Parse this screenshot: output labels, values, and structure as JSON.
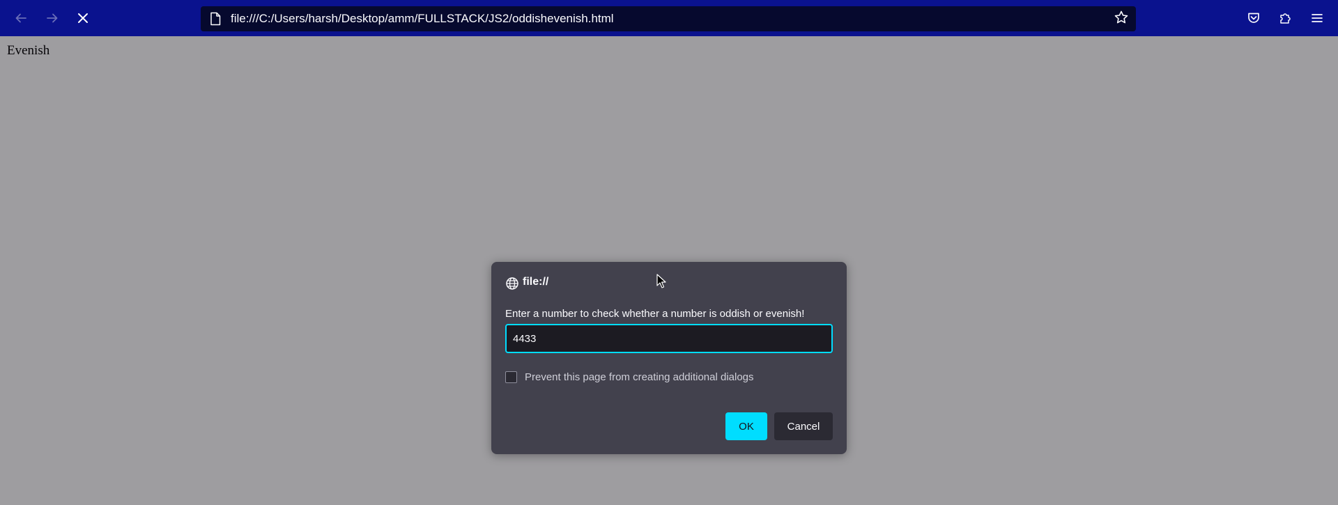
{
  "browser": {
    "url": "file:///C:/Users/harsh/Desktop/amm/FULLSTACK/JS2/oddishevenish.html",
    "toolbar_color": "#0a128e",
    "urlbar_color": "#06092e",
    "icons": {
      "back": "back-arrow-icon",
      "forward": "forward-arrow-icon",
      "stop": "stop-loading-icon",
      "page": "page-icon",
      "bookmark": "star-icon",
      "pocket": "pocket-icon",
      "extensions": "puzzle-extensions-icon",
      "menu": "hamburger-menu-icon"
    }
  },
  "page": {
    "text": "Evenish"
  },
  "dialog": {
    "origin": "file://",
    "message": "Enter a number to check whether a number is oddish or evenish!",
    "input_value": "4433",
    "checkbox_label": "Prevent this page from creating additional dialogs",
    "checkbox_checked": false,
    "ok_label": "OK",
    "cancel_label": "Cancel",
    "accent_color": "#00ddff",
    "background_color": "#42414d"
  }
}
